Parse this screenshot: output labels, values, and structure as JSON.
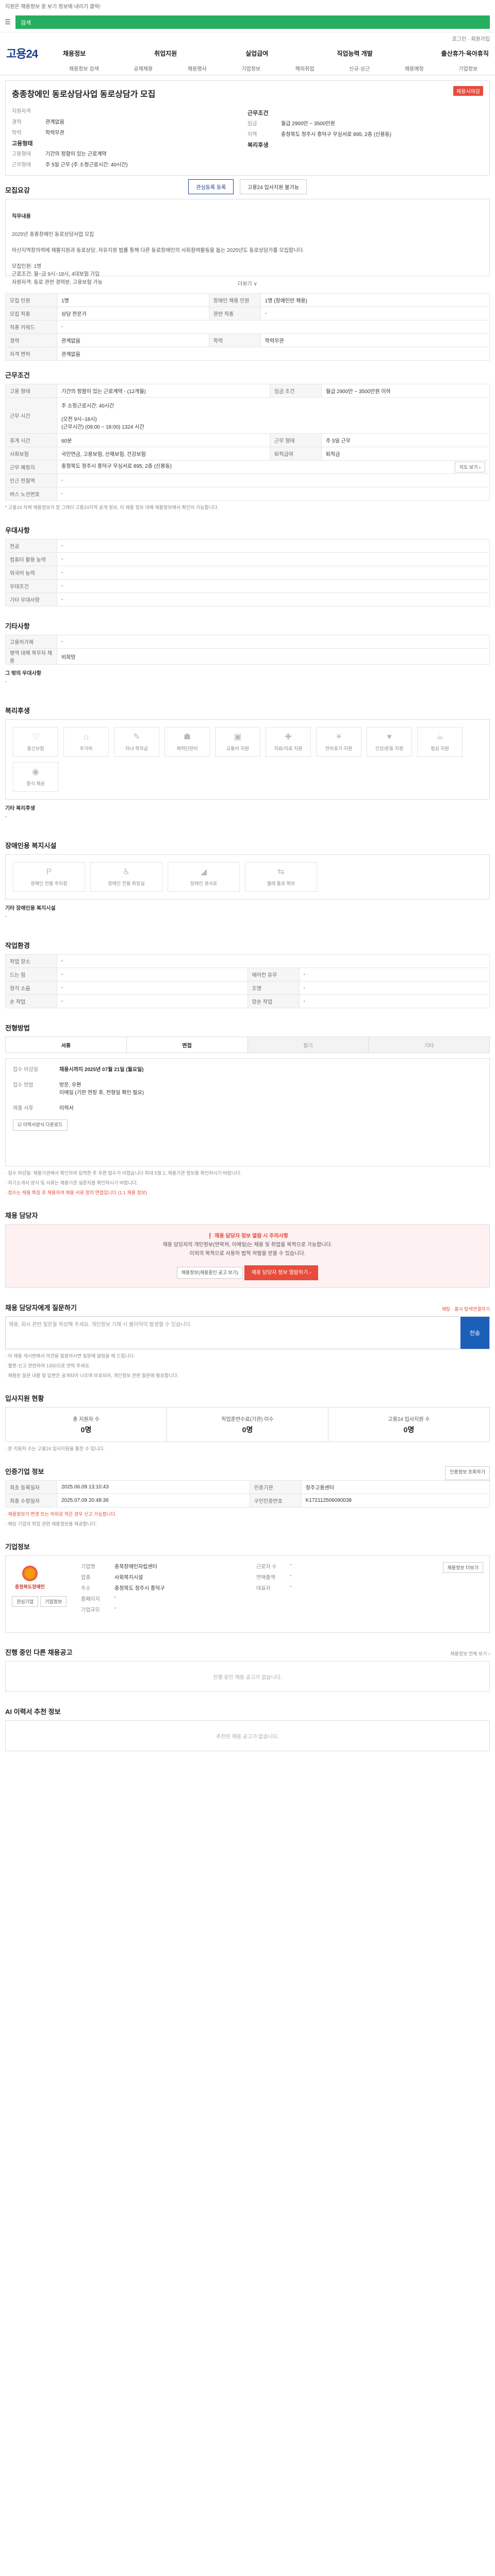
{
  "top_note": "지원은 채용정보 중 보기 정보에 내리기 클릭!",
  "search_placeholder": "검색",
  "top_links": "로그인 · 회원가입",
  "brand": "고용24",
  "main_nav": [
    "채용정보",
    "취업지원",
    "실업급여",
    "직업능력 개발",
    "출산휴가·육아휴직"
  ],
  "sub_nav": [
    "채용정보 검색",
    "공채채용",
    "채용행사",
    "기업정보",
    "해외취업",
    "신규·상근",
    "채용예정",
    "기업정보"
  ],
  "hero": {
    "title": "충종창에인 동로상담사업 동로상담가 모집",
    "badge": "채용시마감",
    "left": [
      {
        "k": "지원자격",
        "v": ""
      },
      {
        "k": "경력",
        "v": "관계없음"
      },
      {
        "k": "학력",
        "v": "학력무관"
      }
    ],
    "left_h2": "고용형태",
    "left2": [
      {
        "k": "고용형태",
        "v": "기간의 정함이 있는 근로계약"
      },
      {
        "k": "근무형태",
        "v": "주 5일 근무 (주 소정근로시간: 40시간)"
      }
    ],
    "right_h": "근무조건",
    "right": [
      {
        "k": "임금",
        "v": "월급 2900만 ~ 3500만원"
      },
      {
        "k": "지역",
        "v": "충청북도 청주시 흥덕구 무심서로 895, 2층 (신봉동)"
      }
    ],
    "right_h2": "복리후생",
    "btn1": "관심등록 등록",
    "btn2": "고용24 입사지원 불가능"
  },
  "recruit": {
    "heading": "모집요강",
    "title_label": "직무내용",
    "body": "2025년 충종창에인 동로상담사업 모집\n\n아산지역창의력에 재활지원과 동로상담, 자유지원 법률 통해 다른 동로창에인의 사회참여활동을 돕는 2025년도 동로상담가를 모집합니다.\n\n모집인원: 1명\n근로조건: 월~금 9시~18시, 4대보험 가입\n자원자격: 동로 관련 경력분, 고용보험 가능",
    "more": "더보기 ∨"
  },
  "recruit_table": [
    [
      {
        "k": "모집 인원",
        "v": "1명"
      },
      {
        "k": "장애인 채용 인원",
        "v": "1명 (장애인만 채용)"
      }
    ],
    [
      {
        "k": "모집 직종",
        "v": "상담 전문가"
      },
      {
        "k": "관련 직종",
        "v": "-"
      }
    ],
    [
      {
        "k": "직종 키워드",
        "v": "-"
      },
      {
        "k": "",
        "v": ""
      }
    ],
    [
      {
        "k": "경력",
        "v": "관계없음"
      },
      {
        "k": "학력",
        "v": "학력무관"
      }
    ],
    [
      {
        "k": "자격 면허",
        "v": "관계없음"
      },
      {
        "k": "",
        "v": ""
      }
    ]
  ],
  "conditions": {
    "heading": "근무조건",
    "rows": [
      [
        {
          "k": "고용 형태",
          "v": "기간의 정함이 있는 근로계약 - (12개월)"
        },
        {
          "k": "임금 조건",
          "v": "월급 2900만 ~ 3500만원 이하"
        }
      ],
      [
        {
          "k": "근무 시간",
          "v": "주 소정근로시간: 40시간\n\n(오전 9시~18시)\n(근무시간) (09:00 ~ 18:00) 1324 시간"
        },
        {
          "k": "",
          "v": ""
        }
      ],
      [
        {
          "k": "휴게 시간",
          "v": "60분"
        },
        {
          "k": "근무 형태",
          "v": "주 5일 근무"
        }
      ],
      [
        {
          "k": "사회보험",
          "v": "국민연금, 고용보험, 산재보험, 건강보험"
        },
        {
          "k": "퇴직급여",
          "v": "퇴직금"
        }
      ],
      [
        {
          "k": "근무 예정지",
          "v": "충청북도 청주시 흥덕구 무심서로 895, 2층 (신봉동)"
        },
        {
          "k": "",
          "v": ""
        }
      ],
      [
        {
          "k": "인근 전철역",
          "v": "-"
        },
        {
          "k": "",
          "v": ""
        }
      ],
      [
        {
          "k": "버스 노선번호",
          "v": "-"
        },
        {
          "k": "",
          "v": ""
        }
      ]
    ],
    "map_btn": "지도 보기 ›",
    "note": "* 고용24 자체 채용정보가 정 그레이 고용24지역 공개 정보, 이 채용 정보 대해 채용정보에서 확인이 가능합니다."
  },
  "pref": {
    "heading": "우대사항",
    "rows": [
      {
        "k": "전공",
        "v": "-"
      },
      {
        "k": "컴퓨터 활용 능력",
        "v": "-"
      },
      {
        "k": "외국어 능력",
        "v": "-"
      },
      {
        "k": "우대조건",
        "v": "-"
      },
      {
        "k": "기타 우대사항",
        "v": "-"
      }
    ]
  },
  "other": {
    "heading": "기타사항",
    "rows": [
      {
        "k": "고용허가제",
        "v": "-"
      },
      {
        "k": "병역 대체 복무자 채용",
        "v": "비희망"
      }
    ],
    "extra_label": "그 밖의 우대사항",
    "extra_value": "-"
  },
  "benefits": {
    "heading": "복리후생",
    "icons": [
      "중신보험",
      "주거비",
      "자녀 학자금",
      "체력단련비",
      "교통비 지원",
      "의료/의료 지원",
      "연차휴가 지원",
      "건강/운동 지원",
      "점심 지원",
      "중식 제공"
    ],
    "etc_label": "기타 복리후생",
    "etc_value": "-"
  },
  "disability": {
    "heading": "장애인용 복지시설",
    "icons": [
      "장애인 전용 주차장",
      "장애인 전용 화장실",
      "장애인 경사로",
      "엘레 통로 확보"
    ],
    "etc_label": "기타 장애인용 복지시설",
    "etc_value": "-"
  },
  "workenv": {
    "heading": "작업환경",
    "rows": [
      [
        {
          "k": "작업 장소",
          "v": "-"
        },
        {
          "k": "",
          "v": ""
        }
      ],
      [
        {
          "k": "드는 힘",
          "v": "-"
        },
        {
          "k": "에어컨 유무",
          "v": "-"
        }
      ],
      [
        {
          "k": "청각 소음",
          "v": "-"
        },
        {
          "k": "조명",
          "v": "-"
        }
      ],
      [
        {
          "k": "손 작업",
          "v": "-"
        },
        {
          "k": "양손 작업",
          "v": "-"
        }
      ]
    ]
  },
  "process": {
    "heading": "전형방법",
    "steps": [
      "서류",
      "면접",
      "필기",
      "기타"
    ],
    "rows": [
      {
        "k": "접수 마감일",
        "v": "채용시까지 2025년 07월 21일 (월요일)",
        "red": true
      },
      {
        "k": "접수 방법",
        "v": "방문, 우편\n이메일 (기한 연장 후, 전형일 확인 필요)"
      },
      {
        "k": "제출 서류",
        "v": "이력서"
      }
    ],
    "download_btn": "☑ 이력서양식 다운로드",
    "notes": [
      "· 접수 마감일: 채용기관에서 확인하여 입력한 후 우편 접수가 어렵습니다 최대 5월 2, 채용기관 정보를 확인하시기 바랍니다.",
      "· 자기소개서 양식 및 서류는 채용기관 설문지를 확인하시기 바랍니다.",
      "· 접수는 채용 특징 후 채용하여 채용 서류 정의 면접입니다 (1:1 채용 정보)"
    ]
  },
  "contact": {
    "heading": "채용 담당자",
    "line1": "❗ 채용 담당자 정보 열람 시 주의사항",
    "line2": "채용 담당자의 개인정보(연락처, 이메일)는 채용 및 취업을 목적으로 가능합니다.",
    "line3": "이외의 목적으로 사용하 법적 처벌을 받을 수 있습니다.",
    "btn1": "채용정보(채용중인 공고 보기)",
    "btn2": "채용 담당자 정보 열람하기 ›"
  },
  "inquiry": {
    "heading": "채용 담당자에게 질문하기",
    "right_link": "채팅 · 홈사 탐색연결하기",
    "placeholder": "채용, 회사 관련 질문을 작성해 주세요. 개인정보 기재 시 불이익이 발생할 수 있습니다.",
    "send": "전송",
    "notes": [
      "· 이 채용 게시판에서 의견을 말씀하시면 질문에 알림을 해 드립니다.",
      "· 불편·신고 관련하여 1350으로 연락 주세요.",
      "· 채용된 질문 내용 및 답변은 공개되어 나오며 보호되어, 개인정보 관련 질문에 필요합니다."
    ]
  },
  "stats": {
    "heading": "입사지원 현황",
    "items": [
      {
        "label": "총 지원자 수",
        "value": "0명"
      },
      {
        "label": "직업훈련수료(기관) 이수",
        "value": "0명"
      },
      {
        "label": "고용24 입사지원 수",
        "value": "0명"
      }
    ],
    "note": "· 본 지원자 수는 고용24 입사지원을 통한 수 입니다."
  },
  "info": {
    "heading": "인증기업 정보",
    "link": "인증정보 조회하기",
    "rows": [
      [
        {
          "k": "최초 등록일자",
          "v": "2025.06.09 13:10:43"
        },
        {
          "k": "인증기관",
          "v": "청주고용센터"
        }
      ],
      [
        {
          "k": "최종 수정일자",
          "v": "2025.07.09 20:48:36"
        },
        {
          "k": "구인인증번호",
          "v": "K172112506090038"
        }
      ]
    ],
    "notes": [
      "· 채용정보가 변경 또는 허위로 적은 경우 신고 가능합니다.",
      "· 해당 기업의 취업 관련 채용정보를 제공합니다."
    ]
  },
  "company": {
    "heading": "기업정보",
    "logo_name": "충청북도장애인",
    "btn_a": "관심기업",
    "btn_b": "기업정보",
    "rows": [
      {
        "k": "기업명",
        "v": "충북장애인자립센터"
      },
      {
        "k": "업종",
        "v": "사회복지시설"
      },
      {
        "k": "주소",
        "v": "충청북도 청주시 흥덕구"
      },
      {
        "k": "홈페이지",
        "v": "-"
      },
      {
        "k": "기업규모",
        "v": "-"
      }
    ],
    "right_rows": [
      {
        "k": "근로자 수",
        "v": "-"
      },
      {
        "k": "연매출액",
        "v": "-"
      },
      {
        "k": "대표자",
        "v": "-"
      }
    ],
    "right_btn": "채용정보 더보기"
  },
  "same_company": {
    "heading": "진행 중인 다른 채용공고",
    "link": "채용정보 전체 보기 ›",
    "empty": "진행 중인 채용 공고가 없습니다."
  },
  "recommend": {
    "heading": "AI 이력서 추천 정보",
    "empty": "추천된 채용 공고가 없습니다."
  }
}
